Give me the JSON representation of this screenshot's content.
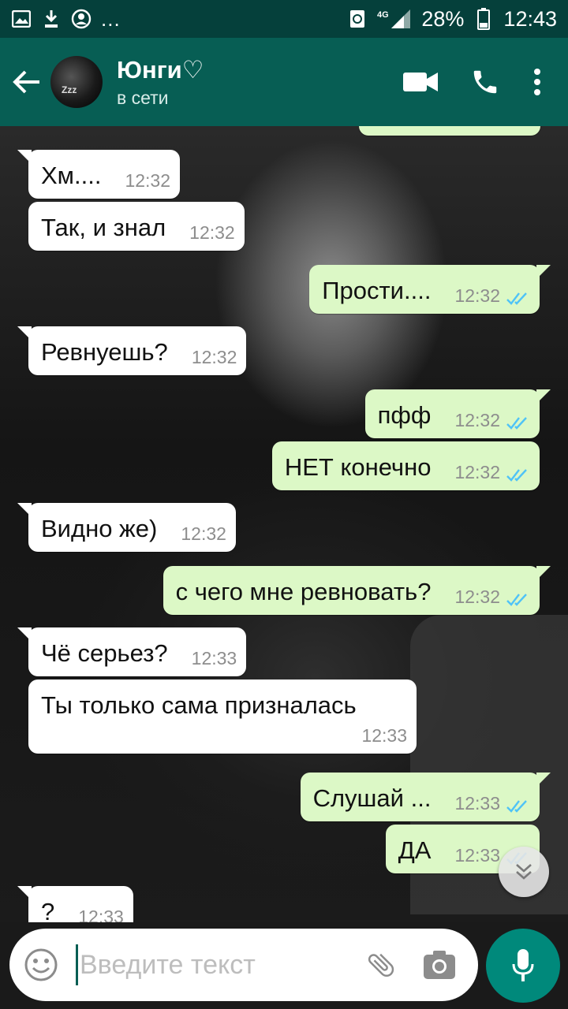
{
  "status_bar": {
    "battery": "28%",
    "time": "12:43",
    "network": "4G",
    "more": "..."
  },
  "header": {
    "contact_name": "Юнги♡",
    "contact_status": "в сети"
  },
  "messages": [
    {
      "direction": "in",
      "text": "Хм....",
      "time": "12:32"
    },
    {
      "direction": "in",
      "text": "Так, и знал",
      "time": "12:32"
    },
    {
      "direction": "out",
      "text": "Прости....",
      "time": "12:32"
    },
    {
      "direction": "in",
      "text": "Ревнуешь?",
      "time": "12:32"
    },
    {
      "direction": "out",
      "text": "пфф",
      "time": "12:32"
    },
    {
      "direction": "out",
      "text": "НЕТ конечно",
      "time": "12:32"
    },
    {
      "direction": "in",
      "text": "Видно же)",
      "time": "12:32"
    },
    {
      "direction": "out",
      "text": "с чего мне ревновать?",
      "time": "12:32"
    },
    {
      "direction": "in",
      "text": "Чё серьез?",
      "time": "12:33"
    },
    {
      "direction": "in",
      "text": "Ты только сама призналась",
      "time": "12:33"
    },
    {
      "direction": "out",
      "text": "Слушай ...",
      "time": "12:33"
    },
    {
      "direction": "out",
      "text": "ДА",
      "time": "12:33"
    },
    {
      "direction": "in",
      "text": "?",
      "time": "12:33"
    }
  ],
  "composer": {
    "placeholder": "Введите текст"
  },
  "colors": {
    "header": "#075e54",
    "status_bar": "#05403b",
    "outgoing_bubble": "#dcf8c6",
    "incoming_bubble": "#ffffff",
    "mic_button": "#00897b",
    "read_ticks": "#4fc3f7"
  },
  "icons": {
    "back": "arrow-left",
    "video": "videocam",
    "call": "phone",
    "menu": "more-vertical",
    "emoji": "smiley",
    "attach": "paperclip",
    "camera": "camera",
    "mic": "microphone",
    "scroll": "double-chevron-down"
  }
}
